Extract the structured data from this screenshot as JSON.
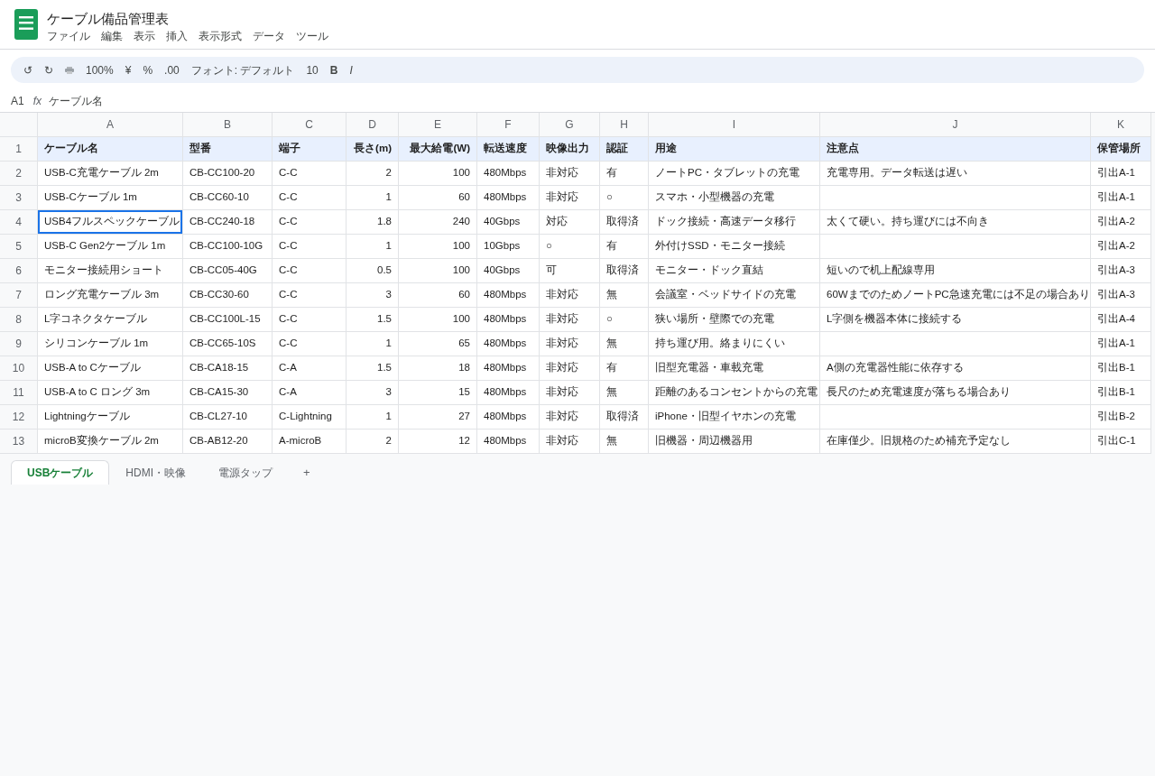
{
  "app": {
    "title": "ケーブル備品管理表",
    "menu": [
      "ファイル",
      "編集",
      "表示",
      "挿入",
      "表示形式",
      "データ",
      "ツール"
    ]
  },
  "toolbar": [
    {
      "kind": "text",
      "label": "↺"
    },
    {
      "kind": "text",
      "label": "↻"
    },
    {
      "kind": "printer"
    },
    {
      "kind": "text",
      "label": "100%"
    },
    {
      "kind": "text",
      "label": "¥"
    },
    {
      "kind": "text",
      "label": "%"
    },
    {
      "kind": "text",
      "label": ".00"
    },
    {
      "kind": "text",
      "label": "フォント: デフォルト"
    },
    {
      "kind": "text",
      "label": "10"
    },
    {
      "kind": "bold",
      "label": "B"
    },
    {
      "kind": "italic",
      "label": "I"
    }
  ],
  "formula_bar": {
    "cell_ref": "A1",
    "fx": "fx",
    "value": "ケーブル名"
  },
  "grid": {
    "columns": [
      "A",
      "B",
      "C",
      "D",
      "E",
      "F",
      "G",
      "H",
      "I",
      "J",
      "K"
    ],
    "rows": [
      {
        "number": "1",
        "kind": "header",
        "cells": [
          {
            "text": "ケーブル名",
            "selected": false
          },
          {
            "text": "型番",
            "selected": false
          },
          {
            "text": "端子",
            "selected": false
          },
          {
            "text": "長さ(m)",
            "selected": false
          },
          {
            "text": "最大給電(W)",
            "selected": false
          },
          {
            "text": "転送速度",
            "selected": false
          },
          {
            "text": "映像出力",
            "selected": false
          },
          {
            "text": "認証",
            "selected": false
          },
          {
            "text": "用途",
            "selected": false
          },
          {
            "text": "注意点",
            "selected": false
          },
          {
            "text": "保管場所",
            "selected": false
          }
        ]
      },
      {
        "number": "2",
        "kind": "data",
        "cells": [
          {
            "text": "USB-C充電ケーブル 2m",
            "selected": false
          },
          {
            "text": "CB-CC100-20",
            "selected": false
          },
          {
            "text": "C-C",
            "selected": false
          },
          {
            "text": "2",
            "selected": false
          },
          {
            "text": "100",
            "selected": false
          },
          {
            "text": "480Mbps",
            "selected": false
          },
          {
            "text": "非対応",
            "selected": false
          },
          {
            "text": "有",
            "selected": false
          },
          {
            "text": "ノートPC・タブレットの充電",
            "selected": false
          },
          {
            "text": "充電専用。データ転送は遅い",
            "selected": false
          },
          {
            "text": "引出A-1",
            "selected": false
          }
        ]
      },
      {
        "number": "3",
        "kind": "data",
        "cells": [
          {
            "text": "USB-Cケーブル 1m",
            "selected": false
          },
          {
            "text": "CB-CC60-10",
            "selected": false
          },
          {
            "text": "C-C",
            "selected": false
          },
          {
            "text": "1",
            "selected": false
          },
          {
            "text": "60",
            "selected": false
          },
          {
            "text": "480Mbps",
            "selected": false
          },
          {
            "text": "非対応",
            "selected": false
          },
          {
            "text": "○",
            "selected": false
          },
          {
            "text": "スマホ・小型機器の充電",
            "selected": false
          },
          {
            "selected": false
          },
          {
            "text": "引出A-1",
            "selected": false
          }
        ]
      },
      {
        "number": "4",
        "kind": "data",
        "cells": [
          {
            "text": "USB4フルスペックケーブル",
            "selected": true
          },
          {
            "text": "CB-CC240-18",
            "selected": false
          },
          {
            "text": "C-C",
            "selected": false
          },
          {
            "text": "1.8",
            "selected": false
          },
          {
            "text": "240",
            "selected": false
          },
          {
            "text": "40Gbps",
            "selected": false
          },
          {
            "text": "対応",
            "selected": false
          },
          {
            "text": "取得済",
            "selected": false
          },
          {
            "text": "ドック接続・高速データ移行",
            "selected": false
          },
          {
            "text": "太くて硬い。持ち運びには不向き",
            "selected": false
          },
          {
            "text": "引出A-2",
            "selected": false
          }
        ]
      },
      {
        "number": "5",
        "kind": "data",
        "cells": [
          {
            "text": "USB-C Gen2ケーブル 1m",
            "selected": false
          },
          {
            "text": "CB-CC100-10G",
            "selected": false
          },
          {
            "text": "C-C",
            "selected": false
          },
          {
            "text": "1",
            "selected": false
          },
          {
            "text": "100",
            "selected": false
          },
          {
            "text": "10Gbps",
            "selected": false
          },
          {
            "text": "○",
            "selected": false
          },
          {
            "text": "有",
            "selected": false
          },
          {
            "text": "外付けSSD・モニター接続",
            "selected": false
          },
          {
            "selected": false
          },
          {
            "text": "引出A-2",
            "selected": false
          }
        ]
      },
      {
        "number": "6",
        "kind": "data",
        "cells": [
          {
            "text": "モニター接続用ショート",
            "selected": false
          },
          {
            "text": "CB-CC05-40G",
            "selected": false
          },
          {
            "text": "C-C",
            "selected": false
          },
          {
            "text": "0.5",
            "selected": false
          },
          {
            "text": "100",
            "selected": false
          },
          {
            "text": "40Gbps",
            "selected": false
          },
          {
            "text": "可",
            "selected": false
          },
          {
            "text": "取得済",
            "selected": false
          },
          {
            "text": "モニター・ドック直結",
            "selected": false
          },
          {
            "text": "短いので机上配線専用",
            "selected": false
          },
          {
            "text": "引出A-3",
            "selected": false
          }
        ]
      },
      {
        "number": "7",
        "kind": "data",
        "cells": [
          {
            "text": "ロング充電ケーブル 3m",
            "selected": false
          },
          {
            "text": "CB-CC30-60",
            "selected": false
          },
          {
            "text": "C-C",
            "selected": false
          },
          {
            "text": "3",
            "selected": false
          },
          {
            "text": "60",
            "selected": false
          },
          {
            "text": "480Mbps",
            "selected": false
          },
          {
            "text": "非対応",
            "selected": false
          },
          {
            "text": "無",
            "selected": false
          },
          {
            "text": "会議室・ベッドサイドの充電",
            "selected": false
          },
          {
            "text": "60WまでのためノートPC急速充電には不足の場合あり",
            "selected": false
          },
          {
            "text": "引出A-3",
            "selected": false
          }
        ]
      },
      {
        "number": "8",
        "kind": "data",
        "cells": [
          {
            "text": "L字コネクタケーブル",
            "selected": false
          },
          {
            "text": "CB-CC100L-15",
            "selected": false
          },
          {
            "text": "C-C",
            "selected": false
          },
          {
            "text": "1.5",
            "selected": false
          },
          {
            "text": "100",
            "selected": false
          },
          {
            "text": "480Mbps",
            "selected": false
          },
          {
            "text": "非対応",
            "selected": false
          },
          {
            "text": "○",
            "selected": false
          },
          {
            "text": "狭い場所・壁際での充電",
            "selected": false
          },
          {
            "text": "L字側を機器本体に接続する",
            "selected": false
          },
          {
            "text": "引出A-4",
            "selected": false
          }
        ]
      },
      {
        "number": "9",
        "kind": "data",
        "cells": [
          {
            "text": "シリコンケーブル 1m",
            "selected": false
          },
          {
            "text": "CB-CC65-10S",
            "selected": false
          },
          {
            "text": "C-C",
            "selected": false
          },
          {
            "text": "1",
            "selected": false
          },
          {
            "text": "65",
            "selected": false
          },
          {
            "text": "480Mbps",
            "selected": false
          },
          {
            "text": "非対応",
            "selected": false
          },
          {
            "text": "無",
            "selected": false
          },
          {
            "text": "持ち運び用。絡まりにくい",
            "selected": false
          },
          {
            "selected": false
          },
          {
            "text": "引出A-1",
            "selected": false
          }
        ]
      },
      {
        "number": "10",
        "kind": "data",
        "cells": [
          {
            "text": "USB-A to Cケーブル",
            "selected": false
          },
          {
            "text": "CB-CA18-15",
            "selected": false
          },
          {
            "text": "C-A",
            "selected": false
          },
          {
            "text": "1.5",
            "selected": false
          },
          {
            "text": "18",
            "selected": false
          },
          {
            "text": "480Mbps",
            "selected": false
          },
          {
            "text": "非対応",
            "selected": false
          },
          {
            "text": "有",
            "selected": false
          },
          {
            "text": "旧型充電器・車載充電",
            "selected": false
          },
          {
            "text": "A側の充電器性能に依存する",
            "selected": false
          },
          {
            "text": "引出B-1",
            "selected": false
          }
        ]
      },
      {
        "number": "11",
        "kind": "data",
        "cells": [
          {
            "text": "USB-A to C ロング 3m",
            "selected": false
          },
          {
            "text": "CB-CA15-30",
            "selected": false
          },
          {
            "text": "C-A",
            "selected": false
          },
          {
            "text": "3",
            "selected": false
          },
          {
            "text": "15",
            "selected": false
          },
          {
            "text": "480Mbps",
            "selected": false
          },
          {
            "text": "非対応",
            "selected": false
          },
          {
            "text": "無",
            "selected": false
          },
          {
            "text": "距離のあるコンセントからの充電",
            "selected": false
          },
          {
            "text": "長尺のため充電速度が落ちる場合あり",
            "selected": false
          },
          {
            "text": "引出B-1",
            "selected": false
          }
        ]
      },
      {
        "number": "12",
        "kind": "data",
        "cells": [
          {
            "text": "Lightningケーブル",
            "selected": false
          },
          {
            "text": "CB-CL27-10",
            "selected": false
          },
          {
            "text": "C-Lightning",
            "selected": false
          },
          {
            "text": "1",
            "selected": false
          },
          {
            "text": "27",
            "selected": false
          },
          {
            "text": "480Mbps",
            "selected": false
          },
          {
            "text": "非対応",
            "selected": false
          },
          {
            "text": "取得済",
            "selected": false
          },
          {
            "text": "iPhone・旧型イヤホンの充電",
            "selected": false
          },
          {
            "selected": false
          },
          {
            "text": "引出B-2",
            "selected": false
          }
        ]
      },
      {
        "number": "13",
        "kind": "data",
        "cells": [
          {
            "text": "microB変換ケーブル 2m",
            "selected": false
          },
          {
            "text": "CB-AB12-20",
            "selected": false
          },
          {
            "text": "A-microB",
            "selected": false
          },
          {
            "text": "2",
            "selected": false
          },
          {
            "text": "12",
            "selected": false
          },
          {
            "text": "480Mbps",
            "selected": false
          },
          {
            "text": "非対応",
            "selected": false
          },
          {
            "text": "無",
            "selected": false
          },
          {
            "text": "旧機器・周辺機器用",
            "selected": false
          },
          {
            "text": "在庫僅少。旧規格のため補充予定なし",
            "selected": false
          },
          {
            "text": "引出C-1",
            "selected": false
          }
        ]
      }
    ]
  },
  "sheet_tabs": {
    "tabs": [
      {
        "label": "USBケーブル",
        "selected": true
      },
      {
        "label": "HDMI・映像",
        "selected": false
      },
      {
        "label": "電源タップ",
        "selected": false
      }
    ],
    "add": "+"
  }
}
